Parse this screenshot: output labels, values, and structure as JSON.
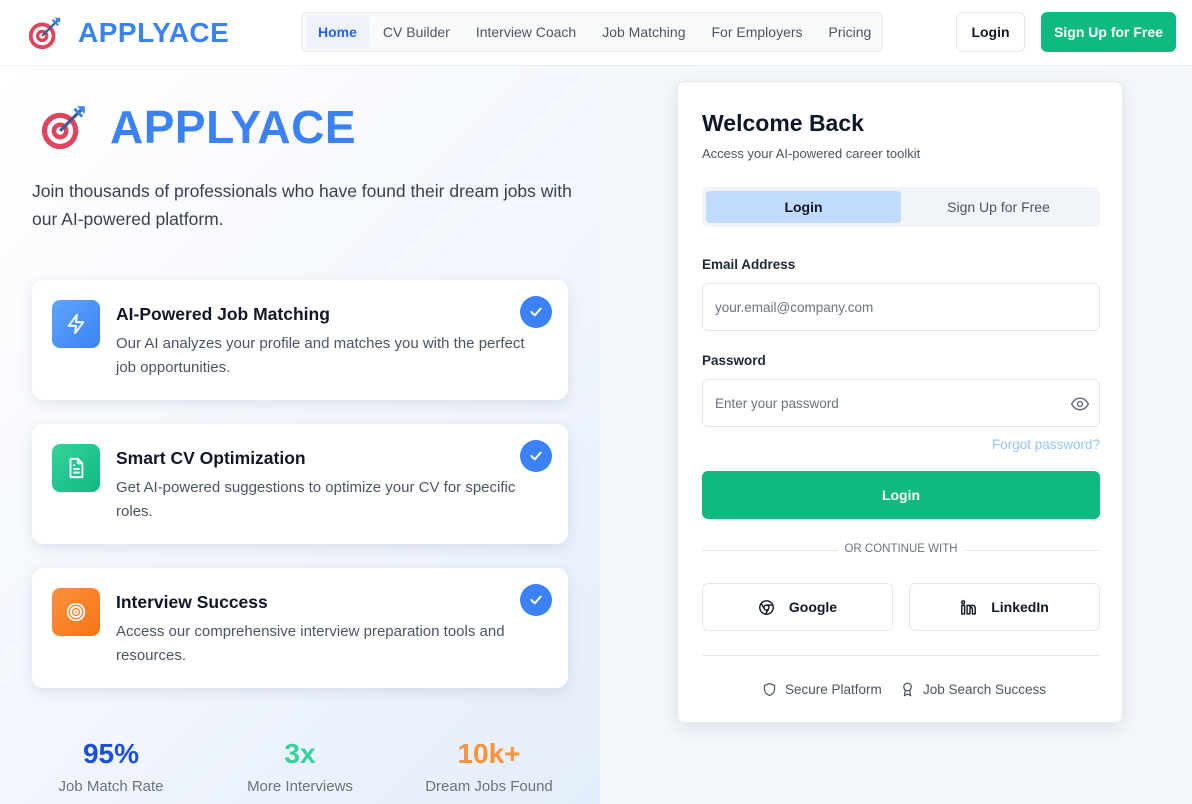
{
  "nav": {
    "brand": "APPLYACE",
    "links": [
      {
        "label": "Home",
        "active": true
      },
      {
        "label": "CV Builder"
      },
      {
        "label": "Interview Coach"
      },
      {
        "label": "Job Matching"
      },
      {
        "label": "For Employers"
      },
      {
        "label": "Pricing"
      }
    ],
    "login_label": "Login",
    "signup_label": "Sign Up for Free"
  },
  "hero": {
    "brand": "APPLYACE",
    "subtitle": "Join thousands of professionals who have found their dream jobs with our AI-powered platform.",
    "features": [
      {
        "icon": "bolt-icon",
        "color": "#3b82f6",
        "title": "AI-Powered Job Matching",
        "description": "Our AI analyzes your profile and matches you with the perfect job opportunities."
      },
      {
        "icon": "document-icon",
        "color": "#10b981",
        "title": "Smart CV Optimization",
        "description": "Get AI-powered suggestions to optimize your CV for specific roles."
      },
      {
        "icon": "target-icon",
        "color": "#f97316",
        "title": "Interview Success",
        "description": "Access our comprehensive interview preparation tools and resources."
      }
    ],
    "stats": [
      {
        "value": "95%",
        "label": "Job Match Rate",
        "color": "#1d4ed8"
      },
      {
        "value": "3x",
        "label": "More Interviews",
        "color": "#34d399"
      },
      {
        "value": "10k+",
        "label": "Dream Jobs Found",
        "color": "#fb923c"
      }
    ]
  },
  "card": {
    "title": "Welcome Back",
    "subtitle": "Access your AI-powered career toolkit",
    "tabs": [
      "Login",
      "Sign Up for Free"
    ],
    "email_label": "Email Address",
    "email_placeholder": "your.email@company.com",
    "email_value": "",
    "password_label": "Password",
    "password_placeholder": "Enter your password",
    "password_value": "",
    "forgot_label": "Forgot password?",
    "login_button": "Login",
    "divider_text": "OR CONTINUE WITH",
    "social": [
      {
        "label": "Google",
        "icon": "chrome-icon"
      },
      {
        "label": "LinkedIn",
        "icon": "linkedin-icon"
      }
    ],
    "trust": [
      {
        "label": "Secure Platform",
        "icon": "shield-icon"
      },
      {
        "label": "Job Search Success",
        "icon": "award-icon"
      }
    ]
  },
  "colors": {
    "accent": "#3b82f6",
    "primary_button": "#10b981"
  }
}
